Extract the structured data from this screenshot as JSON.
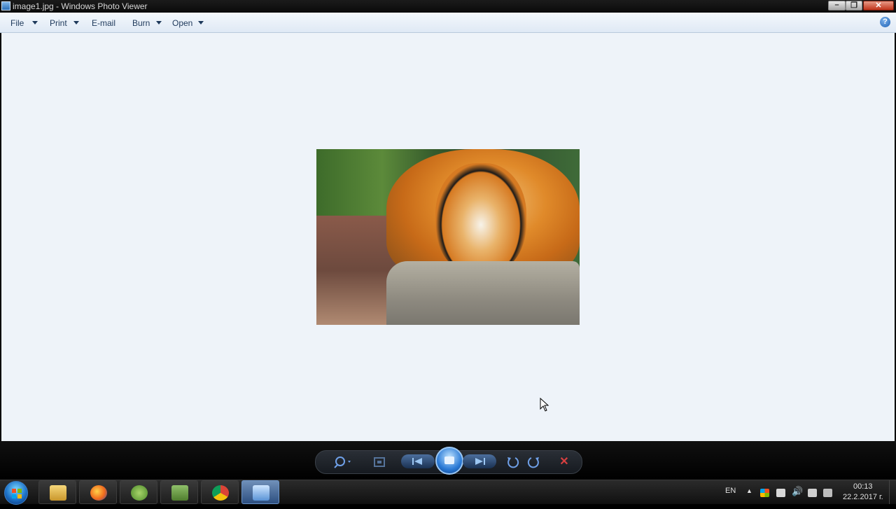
{
  "window": {
    "title": "image1.jpg - Windows Photo Viewer"
  },
  "menu": {
    "items": [
      {
        "label": "File"
      },
      {
        "label": "Print"
      },
      {
        "label": "E-mail"
      },
      {
        "label": "Burn"
      },
      {
        "label": "Open"
      }
    ],
    "help_symbol": "?"
  },
  "controls": {
    "zoom_icon": "magnifier-icon",
    "actual_size_icon": "actual-size-icon",
    "previous_icon": "previous-icon",
    "slideshow_icon": "slideshow-icon",
    "next_icon": "next-icon",
    "rotate_ccw_icon": "rotate-counterclockwise-icon",
    "rotate_cw_icon": "rotate-clockwise-icon",
    "delete_icon": "delete-icon"
  },
  "taskbar": {
    "language": "EN",
    "time": "00:13",
    "date": "22.2.2017 г."
  },
  "colors": {
    "viewer_background": "#eef3f9",
    "menu_text": "#1e395b",
    "accent": "#2a7ad6"
  }
}
